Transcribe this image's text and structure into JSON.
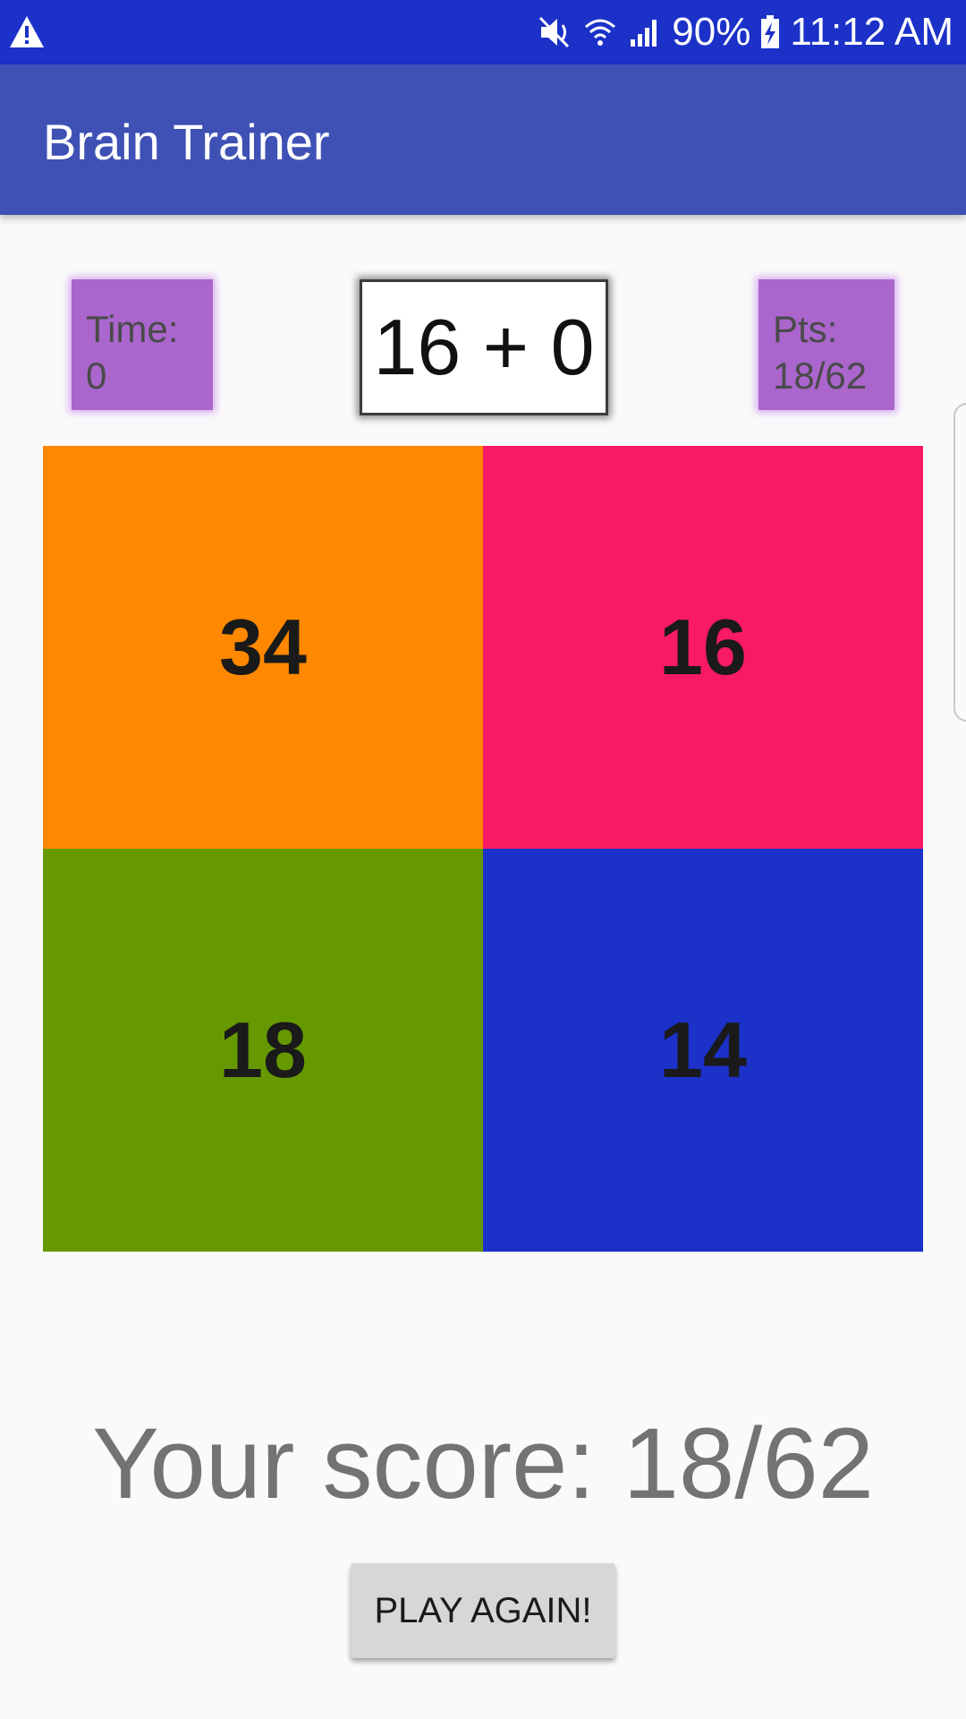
{
  "status_bar": {
    "time": "11:12 AM",
    "battery": "90%",
    "icons": [
      "warning-icon",
      "mute-icon",
      "wifi-icon",
      "signal-icon",
      "battery-charging-icon"
    ]
  },
  "app_bar": {
    "title": "Brain Trainer"
  },
  "timer": {
    "label": "Time:",
    "value": "0"
  },
  "question": "16 + 0",
  "points": {
    "label": "Pts:",
    "value": "18/62"
  },
  "answers": [
    {
      "value": "34",
      "color": "#ff8800"
    },
    {
      "value": "16",
      "color": "#f81a63"
    },
    {
      "value": "18",
      "color": "#669900"
    },
    {
      "value": "14",
      "color": "#1b31c8"
    }
  ],
  "result": {
    "text": "Your score: 18/62"
  },
  "play_again": {
    "label": "PLAY AGAIN!"
  },
  "colors": {
    "status_bar": "#1b31c8",
    "app_bar": "#3f51b5",
    "info_box": "#aa66cc",
    "background": "#fafafa"
  }
}
